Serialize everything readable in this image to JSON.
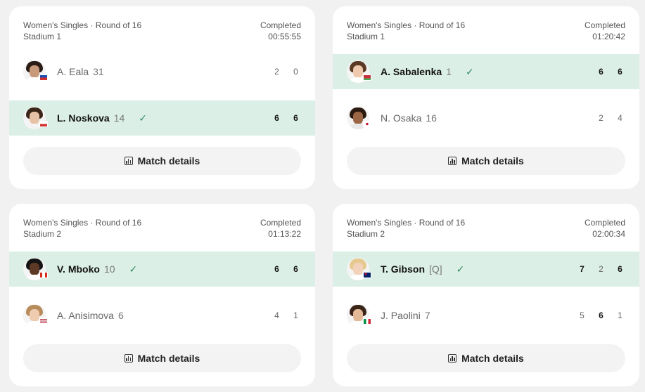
{
  "matches": [
    {
      "event": "Women's Singles · Round of 16",
      "court": "Stadium 1",
      "status": "Completed",
      "duration": "00:55:55",
      "details_label": "Match details",
      "players": [
        {
          "name": "A. Eala",
          "seed": "31",
          "winner": false,
          "flag": "PHI",
          "scores": [
            "2",
            "0"
          ],
          "score_wins": [
            false,
            false
          ]
        },
        {
          "name": "L. Noskova",
          "seed": "14",
          "winner": true,
          "flag": "CZE",
          "scores": [
            "6",
            "6"
          ],
          "score_wins": [
            true,
            true
          ]
        }
      ]
    },
    {
      "event": "Women's Singles · Round of 16",
      "court": "Stadium 1",
      "status": "Completed",
      "duration": "01:20:42",
      "details_label": "Match details",
      "players": [
        {
          "name": "A. Sabalenka",
          "seed": "1",
          "winner": true,
          "flag": "BLR",
          "scores": [
            "6",
            "6"
          ],
          "score_wins": [
            true,
            true
          ]
        },
        {
          "name": "N. Osaka",
          "seed": "16",
          "winner": false,
          "flag": "JPN",
          "scores": [
            "2",
            "4"
          ],
          "score_wins": [
            false,
            false
          ]
        }
      ]
    },
    {
      "event": "Women's Singles · Round of 16",
      "court": "Stadium 2",
      "status": "Completed",
      "duration": "01:13:22",
      "details_label": "Match details",
      "players": [
        {
          "name": "V. Mboko",
          "seed": "10",
          "winner": true,
          "flag": "CAN",
          "scores": [
            "6",
            "6"
          ],
          "score_wins": [
            true,
            true
          ]
        },
        {
          "name": "A. Anisimova",
          "seed": "6",
          "winner": false,
          "flag": "USA",
          "scores": [
            "4",
            "1"
          ],
          "score_wins": [
            false,
            false
          ]
        }
      ]
    },
    {
      "event": "Women's Singles · Round of 16",
      "court": "Stadium 2",
      "status": "Completed",
      "duration": "02:00:34",
      "details_label": "Match details",
      "players": [
        {
          "name": "T. Gibson",
          "seed": "[Q]",
          "winner": true,
          "flag": "AUS",
          "scores": [
            "7",
            "2",
            "6"
          ],
          "score_wins": [
            true,
            false,
            true
          ]
        },
        {
          "name": "J. Paolini",
          "seed": "7",
          "winner": false,
          "flag": "ITA",
          "scores": [
            "5",
            "6",
            "1"
          ],
          "score_wins": [
            false,
            true,
            false
          ]
        }
      ]
    }
  ],
  "colors": {
    "winner_row": "#dcefe7",
    "check": "#2f8c62",
    "card": "#ffffff",
    "page": "#f1f1f1"
  },
  "icons": {
    "winner": "check-icon",
    "details": "bar-chart-icon"
  }
}
